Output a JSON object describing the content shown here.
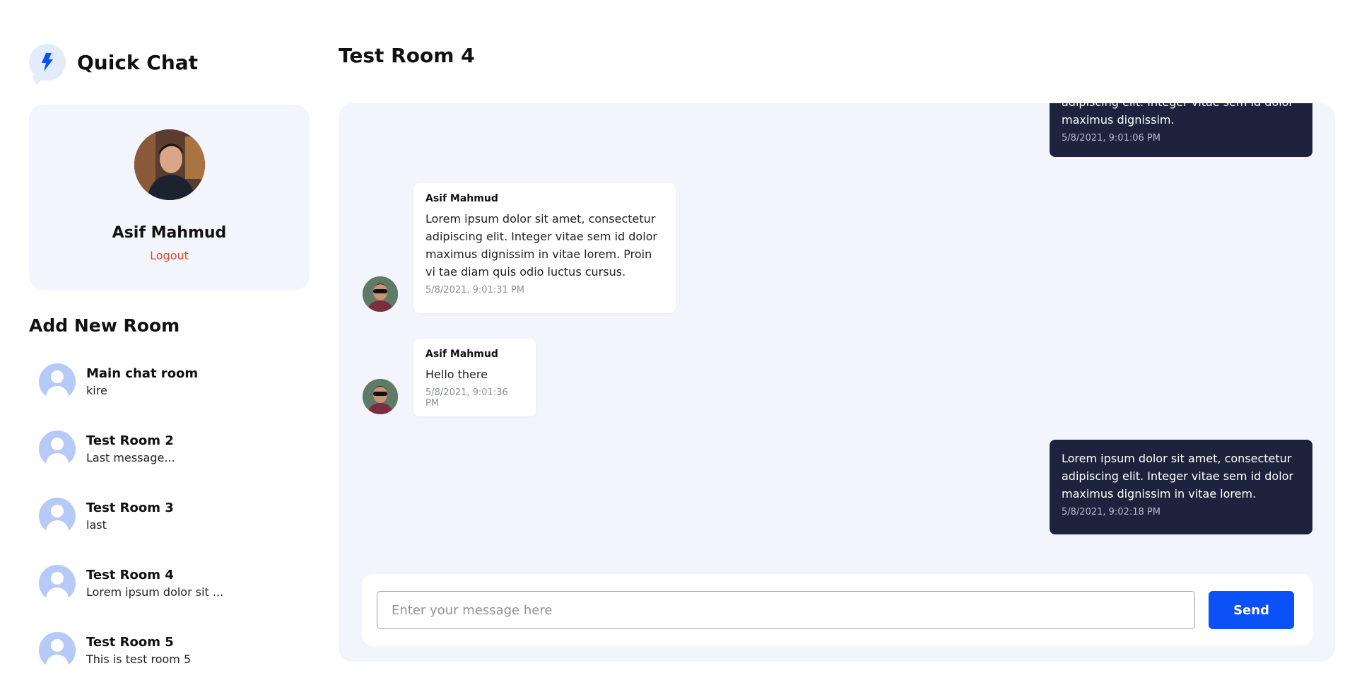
{
  "brand": {
    "title": "Quick Chat",
    "icon": "lightning-bolt-icon",
    "accent": "#0a51f8"
  },
  "profile": {
    "name": "Asif Mahmud",
    "logout_label": "Logout",
    "logout_color": "#e5462f"
  },
  "sidebar": {
    "add_room_label": "Add New Room",
    "rooms": [
      {
        "name": "Main chat room",
        "last_message": "kire"
      },
      {
        "name": "Test Room 2",
        "last_message": "Last message..."
      },
      {
        "name": "Test Room 3",
        "last_message": "last"
      },
      {
        "name": "Test Room 4",
        "last_message": "Lorem ipsum dolor sit ..."
      },
      {
        "name": "Test Room 5",
        "last_message": "This is test room 5"
      }
    ]
  },
  "chat": {
    "title": "Test Room 4",
    "messages": [
      {
        "direction": "outgoing",
        "text_partial_top": "adipiscing elit. Integer vitae sem id dolor",
        "text": "maximus dignissim.",
        "time": "5/8/2021, 9:01:06 PM"
      },
      {
        "direction": "incoming",
        "sender": "Asif Mahmud",
        "text": "Lorem ipsum dolor sit amet, consectetur adipiscing elit. Integer vitae sem id dolor maximus dignissim in vitae lorem. Proin vi tae diam quis odio luctus cursus.",
        "time": "5/8/2021, 9:01:31 PM"
      },
      {
        "direction": "incoming",
        "sender": "Asif Mahmud",
        "text": "Hello there",
        "time": "5/8/2021, 9:01:36 PM"
      },
      {
        "direction": "outgoing",
        "text": "Lorem ipsum dolor sit amet, consectetur adipiscing elit. Integer vitae sem id dolor maximus dignissim in vitae lorem.",
        "time": "5/8/2021, 9:02:18 PM"
      }
    ],
    "outgoing_bubble_color": "#1d233d",
    "panel_color": "#f2f5fb"
  },
  "composer": {
    "placeholder": "Enter your message here",
    "value": "",
    "send_label": "Send"
  }
}
